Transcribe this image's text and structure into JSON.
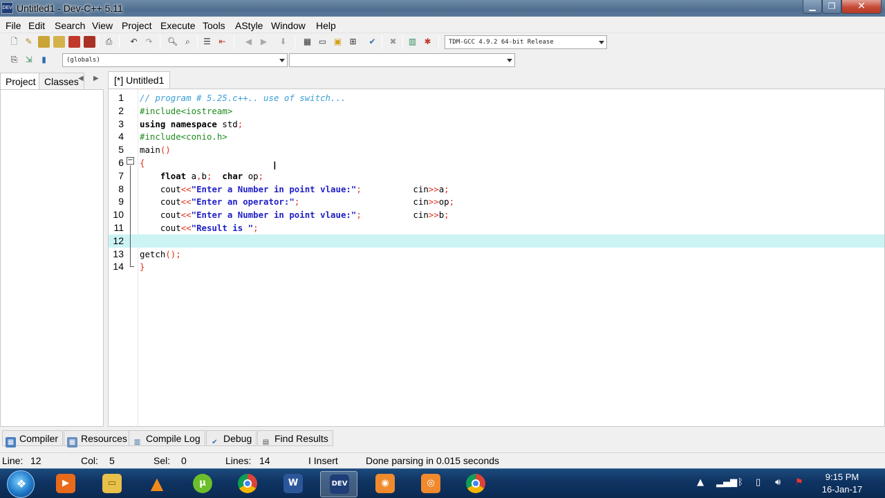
{
  "window": {
    "title": "Untitled1 - Dev-C++ 5.11",
    "icon_text": "DEV"
  },
  "menu": [
    "File",
    "Edit",
    "Search",
    "View",
    "Project",
    "Execute",
    "Tools",
    "AStyle",
    "Window",
    "Help"
  ],
  "toolbar": {
    "compiler_select": "TDM-GCC 4.9.2 64-bit Release",
    "scope_select": "(globals)",
    "member_select": ""
  },
  "left_panel": {
    "tabs": [
      "Project",
      "Classes"
    ]
  },
  "editor": {
    "tab_label": "[*] Untitled1",
    "active_line": 12,
    "lines": [
      {
        "n": "1",
        "html": "<span class=\"cmt\">// program # 5.25.c++.. use of switch...</span>"
      },
      {
        "n": "2",
        "html": "<span class=\"pre\">#include&lt;iostream&gt;</span>"
      },
      {
        "n": "3",
        "html": "<span class=\"kw\">using namespace</span> std<span class=\"op\">;</span>"
      },
      {
        "n": "4",
        "html": "<span class=\"pre\">#include&lt;conio.h&gt;</span>"
      },
      {
        "n": "5",
        "html": "main<span class=\"op\">()</span>"
      },
      {
        "n": "6",
        "html": "<span class=\"op\">{</span>"
      },
      {
        "n": "7",
        "html": "    <span class=\"kw\">float</span> a<span class=\"op\">,</span>b<span class=\"op\">;</span>  <span class=\"kw\">char</span> op<span class=\"op\">;</span>"
      },
      {
        "n": "8",
        "html": "    cout<span class=\"op\">&lt;&lt;</span><span class=\"str\">\"Enter a Number in point vlaue:\"</span><span class=\"op\">;</span>          cin<span class=\"op\">&gt;&gt;</span>a<span class=\"op\">;</span>"
      },
      {
        "n": "9",
        "html": "    cout<span class=\"op\">&lt;&lt;</span><span class=\"str\">\"Enter an operator:\"</span><span class=\"op\">;</span>                      cin<span class=\"op\">&gt;&gt;</span>op<span class=\"op\">;</span>"
      },
      {
        "n": "10",
        "html": "    cout<span class=\"op\">&lt;&lt;</span><span class=\"str\">\"Enter a Number in point vlaue:\"</span><span class=\"op\">;</span>          cin<span class=\"op\">&gt;&gt;</span>b<span class=\"op\">;</span>"
      },
      {
        "n": "11",
        "html": "    cout<span class=\"op\">&lt;&lt;</span><span class=\"str\">\"Result is \"</span><span class=\"op\">;</span>"
      },
      {
        "n": "12",
        "html": ""
      },
      {
        "n": "13",
        "html": "getch<span class=\"op\">();</span>"
      },
      {
        "n": "14",
        "html": "<span class=\"op\">}</span>"
      }
    ]
  },
  "bottom_tabs": [
    "Compiler",
    "Resources",
    "Compile Log",
    "Debug",
    "Find Results"
  ],
  "status": {
    "line_label": "Line:",
    "line_value": "12",
    "col_label": "Col:",
    "col_value": "5",
    "sel_label": "Sel:",
    "sel_value": "0",
    "lines_label": "Lines:",
    "lines_value": "14",
    "mode": "Insert",
    "message": "Done parsing in 0.015 seconds"
  },
  "taskbar": {
    "apps": [
      "windows-media-player",
      "file-explorer",
      "vlc",
      "utorrent",
      "chrome",
      "word",
      "dev-cpp",
      "screen-recorder",
      "screenshot-tool",
      "chrome"
    ],
    "time": "9:15 PM",
    "date": "16-Jan-17"
  }
}
